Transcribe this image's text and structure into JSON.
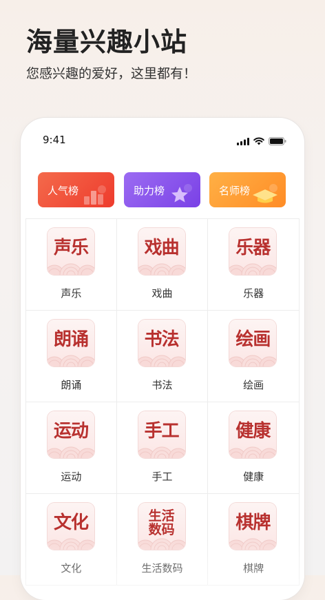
{
  "hero": {
    "title": "海量兴趣小站",
    "subtitle": "您感兴趣的爱好，这里都有！"
  },
  "status_bar": {
    "time": "9:41",
    "icons": [
      "signal-icon",
      "wifi-icon",
      "battery-icon"
    ]
  },
  "rankings": [
    {
      "label": "人气榜",
      "color": "#f0492f"
    },
    {
      "label": "助力榜",
      "color": "#8452ea"
    },
    {
      "label": "名师榜",
      "color": "#ff9a2e"
    }
  ],
  "categories": [
    {
      "tile": [
        "声乐"
      ],
      "label": "声乐"
    },
    {
      "tile": [
        "戏曲"
      ],
      "label": "戏曲"
    },
    {
      "tile": [
        "乐器"
      ],
      "label": "乐器"
    },
    {
      "tile": [
        "朗诵"
      ],
      "label": "朗诵"
    },
    {
      "tile": [
        "书法"
      ],
      "label": "书法"
    },
    {
      "tile": [
        "绘画"
      ],
      "label": "绘画"
    },
    {
      "tile": [
        "运动"
      ],
      "label": "运动"
    },
    {
      "tile": [
        "手工"
      ],
      "label": "手工"
    },
    {
      "tile": [
        "健康"
      ],
      "label": "健康"
    },
    {
      "tile": [
        "文化"
      ],
      "label": "文化"
    },
    {
      "tile": [
        "生活",
        "数码"
      ],
      "label": "生活数码"
    },
    {
      "tile": [
        "棋牌"
      ],
      "label": "棋牌"
    }
  ],
  "colors": {
    "tile_text": "#b8312f",
    "tile_bg": "#fbe8e7"
  }
}
